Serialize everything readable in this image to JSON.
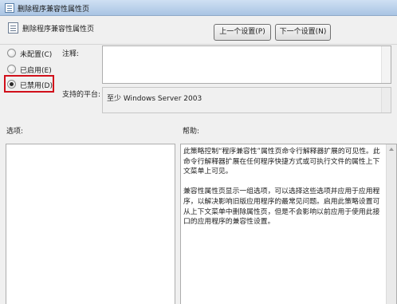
{
  "window": {
    "title": "删除程序兼容性属性页",
    "setting_name": "删除程序兼容性属性页"
  },
  "nav": {
    "prev_label": "上一个设置(P)",
    "next_label": "下一个设置(N)"
  },
  "state_options": [
    {
      "label": "未配置(C)",
      "checked": false
    },
    {
      "label": "已启用(E)",
      "checked": false
    },
    {
      "label": "已禁用(D)",
      "checked": true
    }
  ],
  "highlight_color": "#d10f1a",
  "comment": {
    "label": "注释:",
    "value": ""
  },
  "platform": {
    "label": "支持的平台:",
    "value": "至少 Windows Server 2003"
  },
  "options": {
    "label": "选项:"
  },
  "help": {
    "label": "帮助:",
    "paragraphs": [
      "此策略控制“程序兼容性”属性页命令行解释器扩展的可见性。此命令行解释器扩展在任何程序快捷方式或可执行文件的属性上下文菜单上可见。",
      "兼容性属性页显示一组选项，可以选择这些选项并应用于应用程序，以解决影响旧版应用程序的最常见问题。启用此策略设置可从上下文菜单中删除属性页，但是不会影响以前应用于使用此接口的应用程序的兼容性设置。"
    ]
  }
}
